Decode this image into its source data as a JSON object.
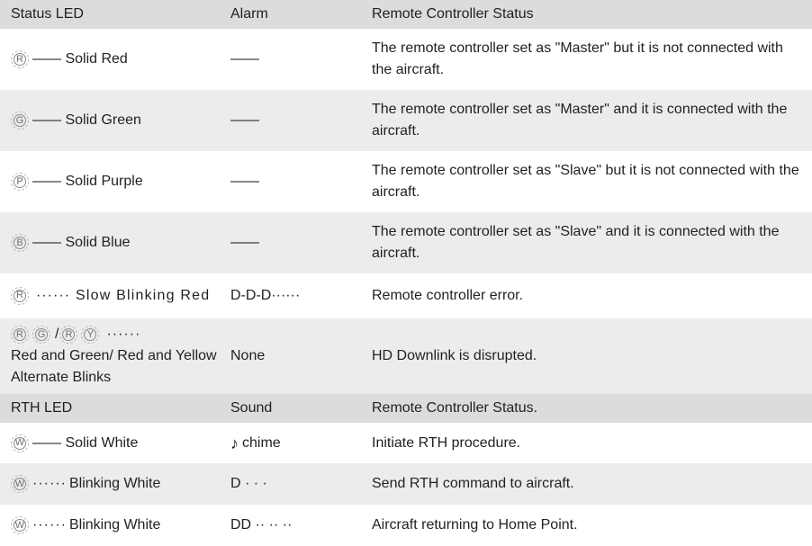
{
  "header1": {
    "col1": "Status LED",
    "col2": "Alarm",
    "col3": "Remote Controller Status"
  },
  "rows1": [
    {
      "led": "R",
      "line": "—— Solid Red",
      "alarm": "——",
      "status": "The remote controller set as \"Master\" but it is not connected with the aircraft."
    },
    {
      "led": "G",
      "line": "—— Solid Green",
      "alarm": "——",
      "status": "The remote controller set as \"Master\" and it is connected with the aircraft."
    },
    {
      "led": "P",
      "line": "—— Solid Purple",
      "alarm": "——",
      "status": "The remote controller set as \"Slave\" but it is not connected with the aircraft."
    },
    {
      "led": "B",
      "line": "—— Solid Blue",
      "alarm": "——",
      "status": "The remote controller set as \"Slave\" and it is connected with the aircraft."
    },
    {
      "led": "R",
      "dots": "······",
      "label": "Slow Blinking Red",
      "alarm": "D-D-D······",
      "status": "Remote controller error."
    }
  ],
  "row_alt": {
    "leds": [
      "R",
      "G",
      "R",
      "Y"
    ],
    "slash": "/",
    "dots": "······",
    "label": "Red and Green/ Red and Yellow Alternate Blinks",
    "alarm": "None",
    "status": "HD Downlink is disrupted."
  },
  "header2": {
    "col1": "RTH LED",
    "col2": "Sound",
    "col3": "Remote Controller Status."
  },
  "rows2": [
    {
      "led": "W",
      "line": "—— Solid White",
      "sound_icon": "♪",
      "sound": "chime",
      "status": "Initiate RTH procedure."
    },
    {
      "led": "W",
      "dots": "······",
      "label": "Blinking White",
      "sound": "D · · ·",
      "status": "Send RTH command to aircraft."
    },
    {
      "led": "W",
      "dots": "······",
      "label": "Blinking White",
      "sound": "DD ·· ·· ··",
      "status": "Aircraft returning to Home Point."
    }
  ]
}
